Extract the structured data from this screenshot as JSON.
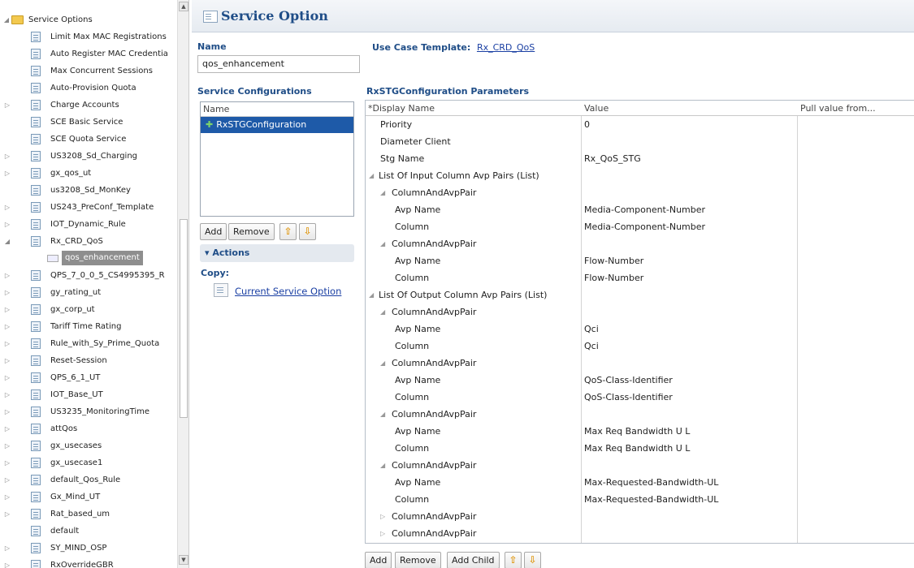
{
  "tree": {
    "root_label": "Service Options",
    "items": [
      {
        "label": "Limit Max MAC Registrations",
        "indent": 1,
        "exp": ""
      },
      {
        "label": "Auto Register MAC Credentia",
        "indent": 1,
        "exp": ""
      },
      {
        "label": "Max Concurrent Sessions",
        "indent": 1,
        "exp": ""
      },
      {
        "label": "Auto-Provision Quota",
        "indent": 1,
        "exp": ""
      },
      {
        "label": "Charge Accounts",
        "indent": 1,
        "exp": "▷"
      },
      {
        "label": "SCE Basic Service",
        "indent": 1,
        "exp": ""
      },
      {
        "label": "SCE Quota Service",
        "indent": 1,
        "exp": ""
      },
      {
        "label": "US3208_Sd_Charging",
        "indent": 1,
        "exp": "▷"
      },
      {
        "label": "gx_qos_ut",
        "indent": 1,
        "exp": "▷"
      },
      {
        "label": "us3208_Sd_MonKey",
        "indent": 1,
        "exp": ""
      },
      {
        "label": "US243_PreConf_Template",
        "indent": 1,
        "exp": "▷"
      },
      {
        "label": "IOT_Dynamic_Rule",
        "indent": 1,
        "exp": "▷"
      },
      {
        "label": "Rx_CRD_QoS",
        "indent": 1,
        "exp": "◢"
      },
      {
        "label": "qos_enhancement",
        "indent": 2,
        "exp": "",
        "selected": true
      },
      {
        "label": "QPS_7_0_0_5_CS4995395_R",
        "indent": 1,
        "exp": "▷"
      },
      {
        "label": "gy_rating_ut",
        "indent": 1,
        "exp": "▷"
      },
      {
        "label": "gx_corp_ut",
        "indent": 1,
        "exp": "▷"
      },
      {
        "label": "Tariff Time Rating",
        "indent": 1,
        "exp": "▷"
      },
      {
        "label": "Rule_with_Sy_Prime_Quota",
        "indent": 1,
        "exp": "▷"
      },
      {
        "label": "Reset-Session",
        "indent": 1,
        "exp": "▷"
      },
      {
        "label": "QPS_6_1_UT",
        "indent": 1,
        "exp": "▷"
      },
      {
        "label": "IOT_Base_UT",
        "indent": 1,
        "exp": "▷"
      },
      {
        "label": "US3235_MonitoringTime",
        "indent": 1,
        "exp": "▷"
      },
      {
        "label": "attQos",
        "indent": 1,
        "exp": "▷"
      },
      {
        "label": "gx_usecases",
        "indent": 1,
        "exp": "▷"
      },
      {
        "label": "gx_usecase1",
        "indent": 1,
        "exp": "▷"
      },
      {
        "label": "default_Qos_Rule",
        "indent": 1,
        "exp": "▷"
      },
      {
        "label": "Gx_Mind_UT",
        "indent": 1,
        "exp": "▷"
      },
      {
        "label": "Rat_based_um",
        "indent": 1,
        "exp": "▷"
      },
      {
        "label": "default",
        "indent": 1,
        "exp": ""
      },
      {
        "label": "SY_MIND_OSP",
        "indent": 1,
        "exp": "▷"
      },
      {
        "label": "RxOverrideGBR",
        "indent": 1,
        "exp": "▷"
      }
    ]
  },
  "header": {
    "title": "Service Option"
  },
  "form": {
    "name_label": "Name",
    "name_value": "qos_enhancement",
    "use_case_label": "Use Case Template:",
    "use_case_link": "Rx_CRD_QoS",
    "service_config_label": "Service Configurations",
    "list_header": "Name",
    "list_item": "RxSTGConfiguration",
    "add": "Add",
    "remove": "Remove",
    "actions_label": "Actions",
    "copy_label": "Copy:",
    "copy_link": "Current Service Option"
  },
  "params": {
    "title": "RxSTGConfiguration Parameters",
    "columns": [
      "*Display Name",
      "Value",
      "Pull value from..."
    ],
    "rows": [
      {
        "name": "Priority",
        "value": "0",
        "indent": 1,
        "exp": ""
      },
      {
        "name": "Diameter Client",
        "value": "",
        "indent": 1,
        "exp": ""
      },
      {
        "name": "Stg Name",
        "value": "Rx_QoS_STG",
        "indent": 1,
        "exp": ""
      },
      {
        "name": "List Of Input Column Avp Pairs (List)",
        "value": "",
        "indent": 0,
        "exp": "◢"
      },
      {
        "name": "ColumnAndAvpPair",
        "value": "",
        "indent": 1,
        "exp": "◢"
      },
      {
        "name": "Avp Name",
        "value": "Media-Component-Number",
        "indent": 2,
        "exp": ""
      },
      {
        "name": "Column",
        "value": "Media-Component-Number",
        "indent": 2,
        "exp": ""
      },
      {
        "name": "ColumnAndAvpPair",
        "value": "",
        "indent": 1,
        "exp": "◢"
      },
      {
        "name": "Avp Name",
        "value": "Flow-Number",
        "indent": 2,
        "exp": ""
      },
      {
        "name": "Column",
        "value": "Flow-Number",
        "indent": 2,
        "exp": ""
      },
      {
        "name": "List Of Output Column Avp Pairs (List)",
        "value": "",
        "indent": 0,
        "exp": "◢"
      },
      {
        "name": "ColumnAndAvpPair",
        "value": "",
        "indent": 1,
        "exp": "◢"
      },
      {
        "name": "Avp Name",
        "value": "Qci",
        "indent": 2,
        "exp": ""
      },
      {
        "name": "Column",
        "value": "Qci",
        "indent": 2,
        "exp": ""
      },
      {
        "name": "ColumnAndAvpPair",
        "value": "",
        "indent": 1,
        "exp": "◢"
      },
      {
        "name": "Avp Name",
        "value": "QoS-Class-Identifier",
        "indent": 2,
        "exp": ""
      },
      {
        "name": "Column",
        "value": "QoS-Class-Identifier",
        "indent": 2,
        "exp": ""
      },
      {
        "name": "ColumnAndAvpPair",
        "value": "",
        "indent": 1,
        "exp": "◢"
      },
      {
        "name": "Avp Name",
        "value": "Max Req Bandwidth U L",
        "indent": 2,
        "exp": ""
      },
      {
        "name": "Column",
        "value": "Max Req Bandwidth U L",
        "indent": 2,
        "exp": ""
      },
      {
        "name": "ColumnAndAvpPair",
        "value": "",
        "indent": 1,
        "exp": "◢"
      },
      {
        "name": "Avp Name",
        "value": "Max-Requested-Bandwidth-UL",
        "indent": 2,
        "exp": ""
      },
      {
        "name": "Column",
        "value": "Max-Requested-Bandwidth-UL",
        "indent": 2,
        "exp": ""
      },
      {
        "name": "ColumnAndAvpPair",
        "value": "",
        "indent": 1,
        "exp": "▷"
      },
      {
        "name": "ColumnAndAvpPair",
        "value": "",
        "indent": 1,
        "exp": "▷"
      }
    ],
    "add": "Add",
    "remove": "Remove",
    "add_child": "Add Child"
  }
}
